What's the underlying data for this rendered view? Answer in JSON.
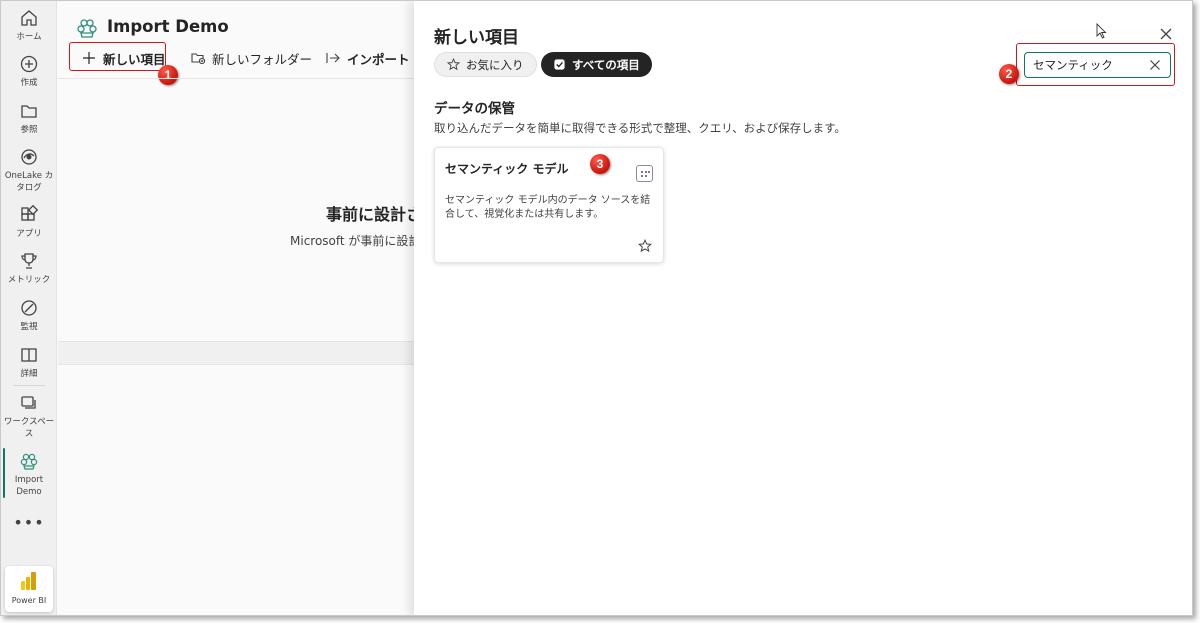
{
  "rail": {
    "items": [
      {
        "label": "ホーム",
        "icon": "home-icon"
      },
      {
        "label": "作成",
        "icon": "plus-circle-icon"
      },
      {
        "label": "参照",
        "icon": "folder-icon"
      },
      {
        "label": "OneLake カタログ",
        "icon": "onelake-icon"
      },
      {
        "label": "アプリ",
        "icon": "apps-icon"
      },
      {
        "label": "メトリック",
        "icon": "trophy-icon"
      },
      {
        "label": "監視",
        "icon": "monitor-icon"
      },
      {
        "label": "詳細",
        "icon": "book-icon"
      },
      {
        "label": "ワークスペース",
        "icon": "workspaces-icon"
      },
      {
        "label": "Import Demo",
        "icon": "workspace-flower-icon"
      }
    ],
    "more": "•••",
    "powerbi_label": "Power BI"
  },
  "workspace": {
    "title": "Import Demo",
    "toolbar": {
      "new_item": "新しい項目",
      "new_folder": "新しいフォルダー",
      "import": "インポート"
    },
    "empty_heading": "事前に設計さ",
    "empty_sub": "Microsoft が事前に設計"
  },
  "panel": {
    "title": "新しい項目",
    "filters": {
      "favorites": "お気に入り",
      "all_items": "すべての項目"
    },
    "search": {
      "value": "セマンティック"
    },
    "section": {
      "title": "データの保管",
      "description": "取り込んだデータを簡単に取得できる形式で整理、クエリ、および保存します。"
    },
    "card": {
      "title": "セマンティック モデル",
      "description": "セマンティック モデル内のデータ ソースを結合して、視覚化または共有します。"
    }
  },
  "annotations": {
    "badge1": "1",
    "badge2": "2",
    "badge3": "3"
  },
  "colors": {
    "accent": "#117865",
    "callout_red": "#d01818",
    "pill_dark": "#242424"
  }
}
